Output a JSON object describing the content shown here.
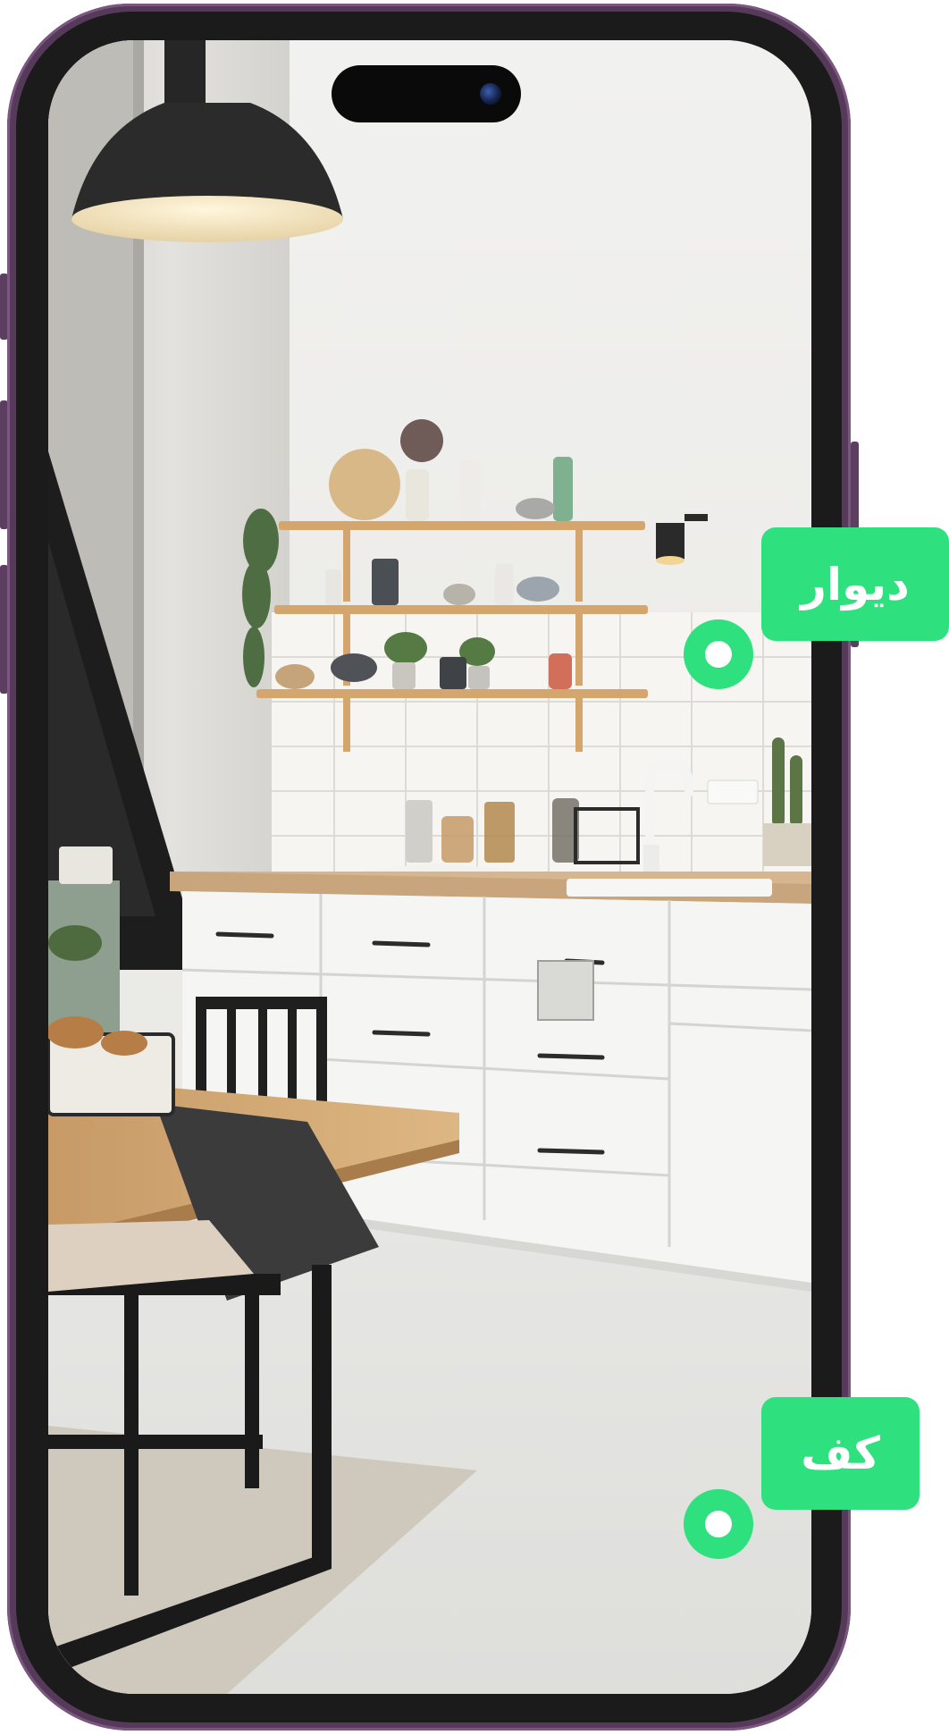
{
  "labels": {
    "wall": "دیوار",
    "floor": "کف"
  },
  "colors": {
    "frame": "#563a5a",
    "bezel": "#1c1b1c",
    "accent_green": "#2fe07f"
  }
}
